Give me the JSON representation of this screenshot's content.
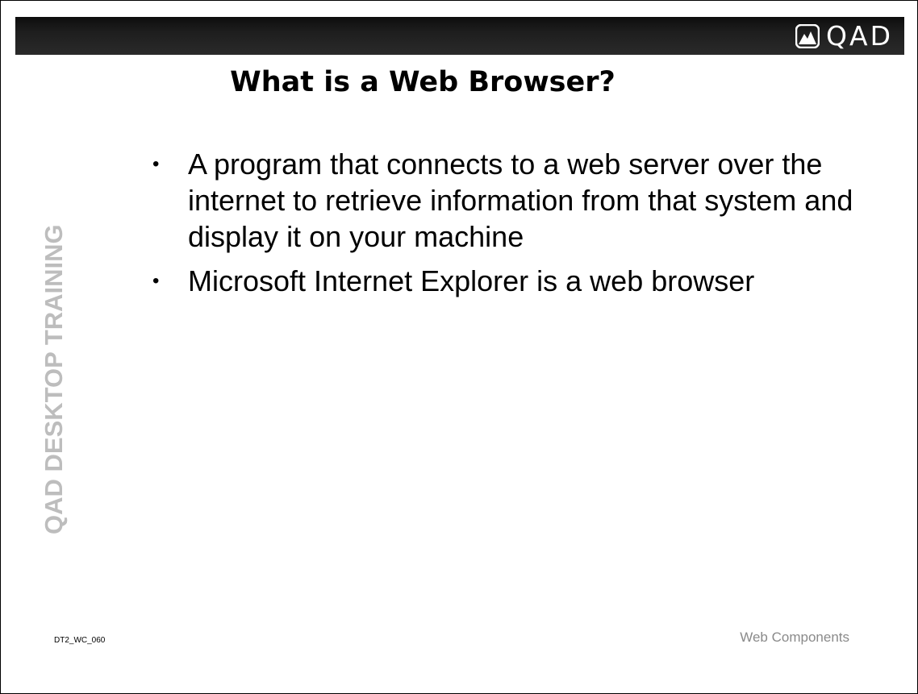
{
  "header": {
    "logo_text": "QAD"
  },
  "slide": {
    "title": "What is a Web Browser?",
    "watermark": "QAD DESKTOP TRAINING",
    "bullets": [
      {
        "marker": "•",
        "text": "A program that connects to a web server over the internet to retrieve information from that system and display it on your machine"
      },
      {
        "marker": "•",
        "text": "Microsoft Internet Explorer is a web browser"
      }
    ]
  },
  "footer": {
    "code": "DT2_WC_060",
    "section": "Web Components"
  },
  "colors": {
    "band": "#1e1e1e",
    "watermark": "#bdbdbd",
    "footer_section": "#8a8a8a"
  }
}
